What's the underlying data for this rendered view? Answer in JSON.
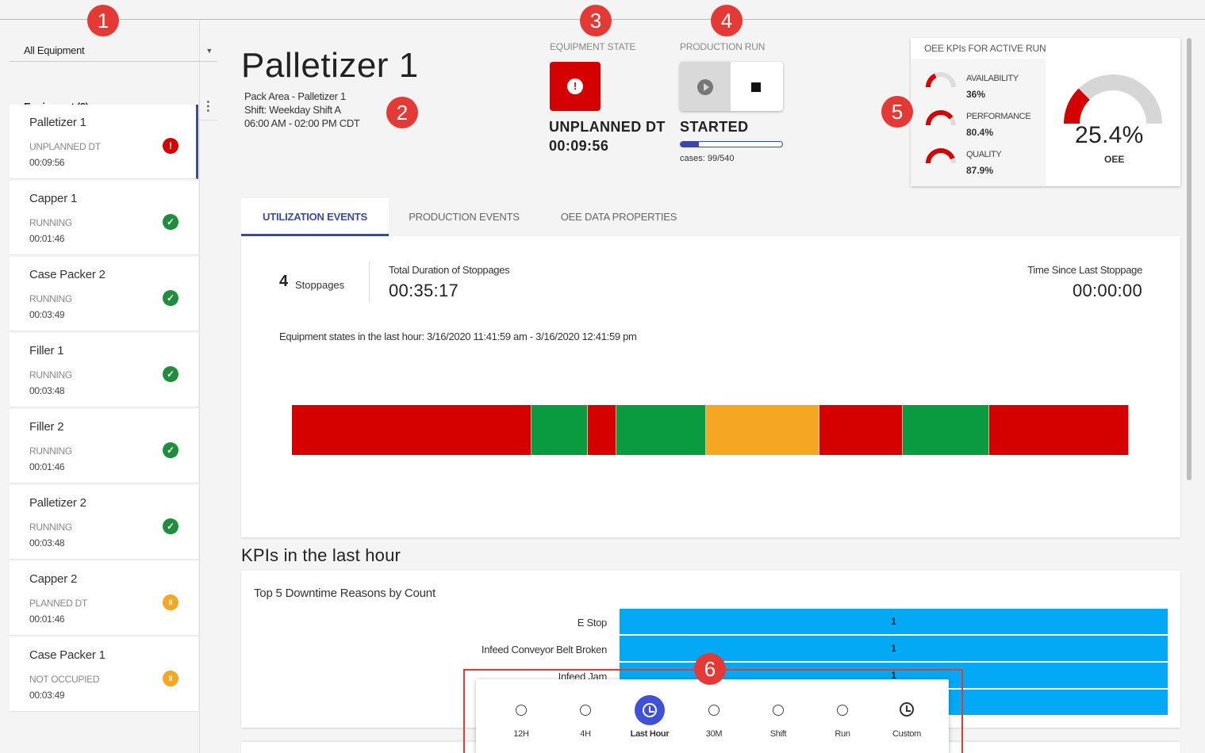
{
  "sidebar": {
    "filter_label": "All Equipment",
    "equipment_header": "Equipment (8)",
    "items": [
      {
        "name": "Palletizer 1",
        "status": "UNPLANNED DT",
        "time": "00:09:56",
        "icon": "!",
        "icon_type": "err"
      },
      {
        "name": "Capper 1",
        "status": "RUNNING",
        "time": "00:01:46",
        "icon": "✓",
        "icon_type": "ok"
      },
      {
        "name": "Case Packer 2",
        "status": "RUNNING",
        "time": "00:03:49",
        "icon": "✓",
        "icon_type": "ok"
      },
      {
        "name": "Filler 1",
        "status": "RUNNING",
        "time": "00:03:48",
        "icon": "✓",
        "icon_type": "ok"
      },
      {
        "name": "Filler 2",
        "status": "RUNNING",
        "time": "00:01:46",
        "icon": "✓",
        "icon_type": "ok"
      },
      {
        "name": "Palletizer 2",
        "status": "RUNNING",
        "time": "00:03:48",
        "icon": "✓",
        "icon_type": "ok"
      },
      {
        "name": "Capper 2",
        "status": "PLANNED DT",
        "time": "00:01:46",
        "icon": "II",
        "icon_type": "pause"
      },
      {
        "name": "Case Packer 1",
        "status": "NOT OCCUPIED",
        "time": "00:03:49",
        "icon": "II",
        "icon_type": "pause"
      }
    ]
  },
  "header": {
    "title": "Palletizer 1",
    "area": "Pack Area - Palletizer 1",
    "shift": "Shift: Weekday Shift A",
    "shift_time": "06:00 AM - 02:00 PM CDT"
  },
  "equipment_state": {
    "label": "EQUIPMENT STATE",
    "status": "UNPLANNED DT",
    "time": "00:09:56",
    "icon": "!"
  },
  "production_run": {
    "label": "PRODUCTION RUN",
    "status": "STARTED",
    "cases_text": "cases: 99/540",
    "progress": 0.183
  },
  "oee": {
    "title": "OEE KPIs FOR ACTIVE RUN",
    "kpis": [
      {
        "label": "AVAILABILITY",
        "value": "36%",
        "fraction": 0.36
      },
      {
        "label": "PERFORMANCE",
        "value": "80.4%",
        "fraction": 0.804
      },
      {
        "label": "QUALITY",
        "value": "87.9%",
        "fraction": 0.879
      }
    ],
    "value": "25.4%",
    "fraction": 0.254,
    "label": "OEE"
  },
  "tabs": [
    "UTILIZATION EVENTS",
    "PRODUCTION EVENTS",
    "OEE DATA PROPERTIES"
  ],
  "utilization": {
    "stoppage_count": "4",
    "stoppage_label": "Stoppages",
    "total_label": "Total Duration of Stoppages",
    "total_value": "00:35:17",
    "since_label": "Time Since Last Stoppage",
    "since_value": "00:00:00",
    "range_text": "Equipment states in the last hour: 3/16/2020 11:41:59 am - 3/16/2020 12:41:59 pm",
    "timeline": [
      {
        "state": "down",
        "fraction": 0.286
      },
      {
        "state": "running",
        "fraction": 0.068
      },
      {
        "state": "down",
        "fraction": 0.034
      },
      {
        "state": "running",
        "fraction": 0.107
      },
      {
        "state": "planned",
        "fraction": 0.135
      },
      {
        "state": "down",
        "fraction": 0.1
      },
      {
        "state": "running",
        "fraction": 0.103
      },
      {
        "state": "down",
        "fraction": 0.167
      }
    ]
  },
  "kpi_section": {
    "heading": "KPIs in the last hour",
    "chart_title": "Top 5 Downtime Reasons by Count",
    "bars": [
      {
        "label": "E Stop",
        "value": "1"
      },
      {
        "label": "Infeed Conveyor Belt Broken",
        "value": "1"
      },
      {
        "label": "Infeed Jam",
        "value": "1"
      },
      {
        "label": "",
        "value": ""
      }
    ]
  },
  "time_picker": {
    "options": [
      {
        "label": "12H",
        "selected": false,
        "type": "radio"
      },
      {
        "label": "4H",
        "selected": false,
        "type": "radio"
      },
      {
        "label": "Last Hour",
        "selected": true,
        "type": "radio"
      },
      {
        "label": "30M",
        "selected": false,
        "type": "radio"
      },
      {
        "label": "Shift",
        "selected": false,
        "type": "radio"
      },
      {
        "label": "Run",
        "selected": false,
        "type": "radio"
      },
      {
        "label": "Custom",
        "selected": false,
        "type": "clock"
      }
    ]
  },
  "markers": [
    "1",
    "2",
    "3",
    "4",
    "5",
    "6"
  ],
  "colors": {
    "down": "#d50000",
    "running": "#0a9a3f",
    "planned": "#f5a623",
    "accent": "#3949ab",
    "bar": "#03a9f4",
    "marker": "#e53935"
  }
}
